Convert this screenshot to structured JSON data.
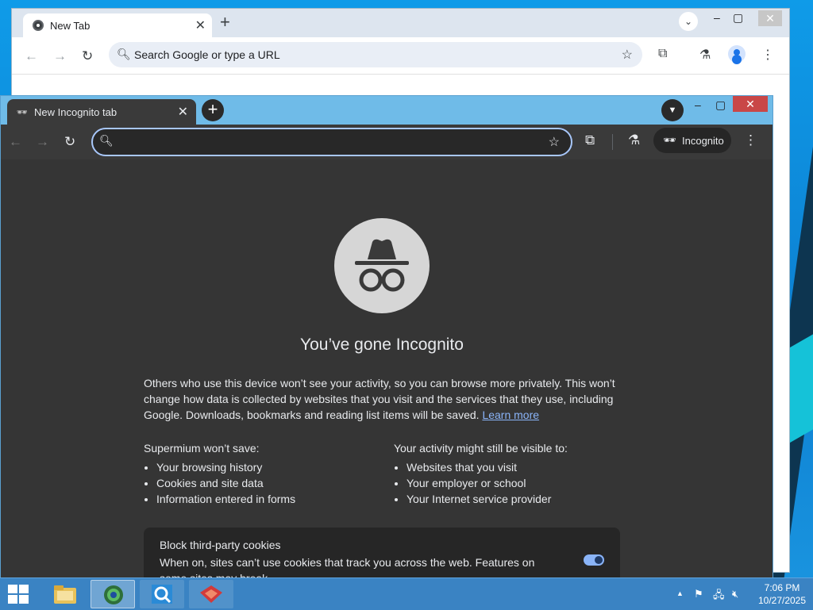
{
  "background_window": {
    "tab_title": "New Tab",
    "omnibox_placeholder": "Search Google or type a URL"
  },
  "incognito_window": {
    "tab_title": "New Incognito tab",
    "omnibox_value": "",
    "badge_label": "Incognito",
    "heading": "You’ve gone Incognito",
    "intro": "Others who use this device won’t see your activity, so you can browse more privately. This won’t change how data is collected by websites that you visit and the services that they use, including Google. Downloads, bookmarks and reading list items will be saved.",
    "learn_more": "Learn more",
    "wont_save": {
      "heading": "Supermium won’t save:",
      "items": [
        "Your browsing history",
        "Cookies and site data",
        "Information entered in forms"
      ]
    },
    "might_be_visible": {
      "heading": "Your activity might still be visible to:",
      "items": [
        "Websites that you visit",
        "Your employer or school",
        "Your Internet service provider"
      ]
    },
    "cookie_card": {
      "title": "Block third-party cookies",
      "description": "When on, sites can’t use cookies that track you across the web. Features on some sites may break",
      "toggle_on": true
    }
  },
  "taskbar": {
    "time": "7:06 PM",
    "date": "10/27/2025",
    "pinned": [
      "file-explorer-icon",
      "browser-icon",
      "search-tool-icon",
      "app-icon"
    ]
  },
  "colors": {
    "incognito_bg": "#353535",
    "tabstrip_accent": "#6fbbe8",
    "link": "#8ab4f8",
    "taskbar": "#3a83c3"
  }
}
